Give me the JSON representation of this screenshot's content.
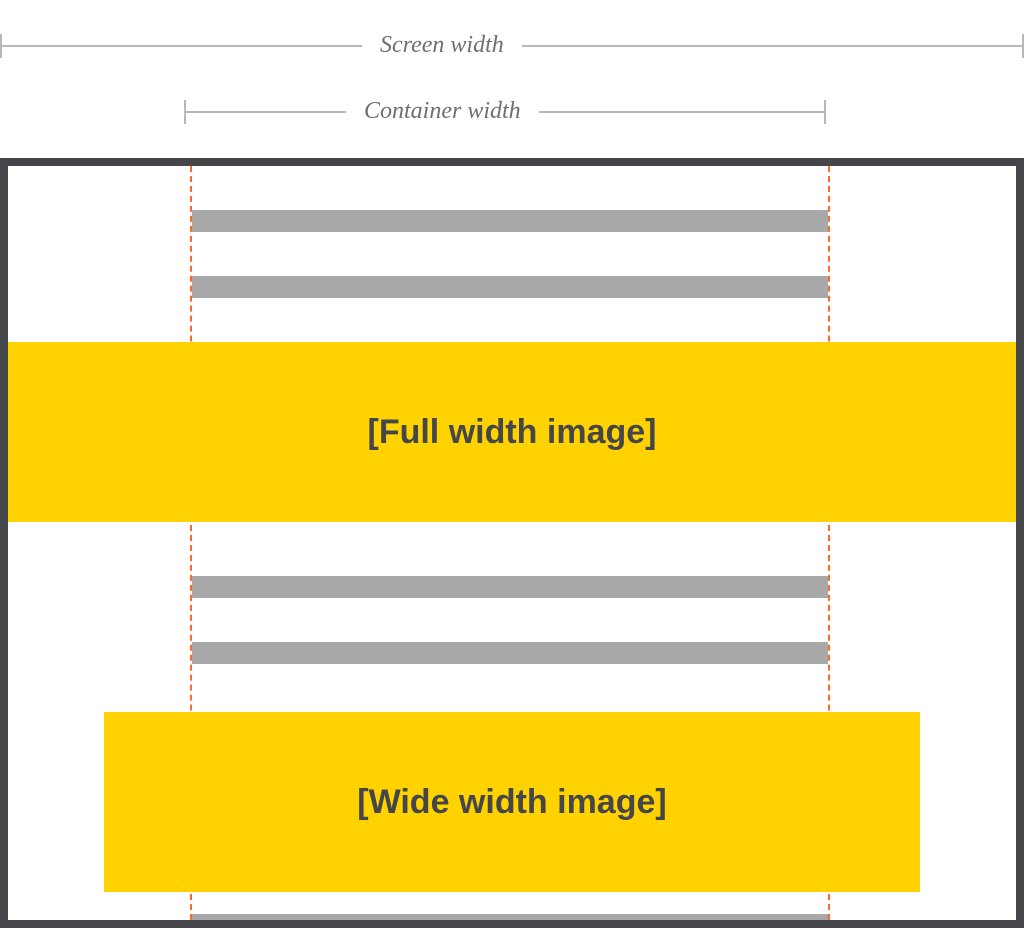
{
  "dimensions": {
    "screen_label": "Screen width",
    "container_label": "Container width"
  },
  "blocks": {
    "full_label": "[Full width image]",
    "wide_label": "[Wide width image]"
  },
  "colors": {
    "frame": "#454649",
    "image_block": "#ffd200",
    "text_bar": "#a8a8a8",
    "guide": "#ff6a2a",
    "dim_line": "#b8b8b8",
    "label_text": "#454649"
  }
}
